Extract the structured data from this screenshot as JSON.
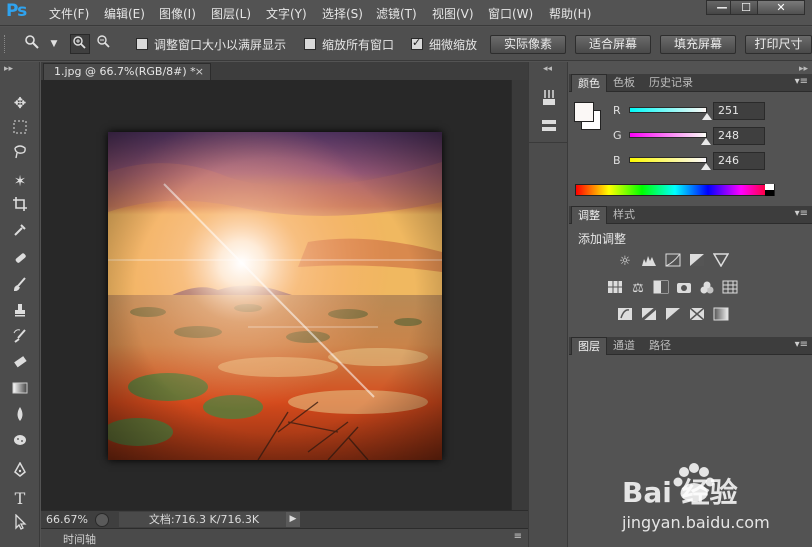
{
  "app": {
    "logo": "Ps"
  },
  "menu": [
    "文件(F)",
    "编辑(E)",
    "图像(I)",
    "图层(L)",
    "文字(Y)",
    "选择(S)",
    "滤镜(T)",
    "视图(V)",
    "窗口(W)",
    "帮助(H)"
  ],
  "window_controls": {
    "minimize": "—",
    "maximize": "☐",
    "close": "✕"
  },
  "options_bar": {
    "tool_icon": "zoom-icon",
    "zoom_in_icon": "zoom-in-icon",
    "zoom_out_icon": "zoom-out-icon",
    "resize_windows_label": "调整窗口大小以满屏显示",
    "resize_windows_checked": false,
    "zoom_all_label": "缩放所有窗口",
    "zoom_all_checked": false,
    "scrubby_zoom_label": "细微缩放",
    "scrubby_zoom_checked": true,
    "buttons": [
      "实际像素",
      "适合屏幕",
      "填充屏幕",
      "打印尺寸"
    ]
  },
  "document": {
    "tab_title": "1.jpg @ 66.7%(RGB/8#) *",
    "tab_close": "×",
    "zoom_level": "66.67%",
    "doc_info": "文档:716.3 K/716.3K",
    "timeline_label": "时间轴"
  },
  "color_panel": {
    "tabs": [
      "颜色",
      "色板",
      "历史记录"
    ],
    "r_label": "R",
    "r_value": "251",
    "g_label": "G",
    "g_value": "248",
    "b_label": "B",
    "b_value": "246",
    "foreground_color": "#fbf8f6",
    "background_color": "#ffffff"
  },
  "adjustments_panel": {
    "tabs": [
      "调整",
      "样式"
    ],
    "title": "添加调整"
  },
  "layers_panel": {
    "tabs": [
      "图层",
      "通道",
      "路径"
    ]
  },
  "watermark": {
    "logo": "Bai 经验",
    "url": "jingyan.baidu.com"
  },
  "colors": {
    "ui_bg": "#535353",
    "canvas_bg": "#282828",
    "logo_blue": "#2fa3ef"
  }
}
